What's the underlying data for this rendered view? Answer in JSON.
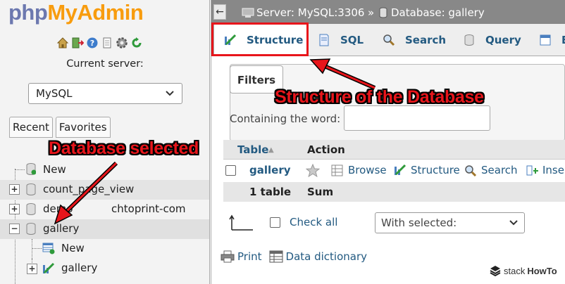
{
  "nav": {
    "logo_php": "php",
    "logo_myadmin": "MyAdmin",
    "icons": [
      "home-icon",
      "logout-icon",
      "help-icon",
      "docs-icon",
      "settings-icon",
      "reload-icon"
    ],
    "current_server_label": "Current server:",
    "server_select_value": "MySQL",
    "tabs": [
      "Recent",
      "Favorites"
    ],
    "tree": [
      {
        "label": "New",
        "level": 0
      },
      {
        "label": "count_page_view",
        "level": 0
      },
      {
        "label": "demo_...chtoprint-com",
        "label_left": "demo",
        "label_right": "chtoprint-com",
        "level": 0
      },
      {
        "label": "gallery",
        "level": 0,
        "expanded": true
      },
      {
        "label": "New",
        "level": 1
      },
      {
        "label": "gallery",
        "level": 1
      }
    ]
  },
  "breadcrumb": {
    "server": "Server: MySQL:3306",
    "separator": "»",
    "database": "Database: gallery"
  },
  "tabs": [
    {
      "label": "Structure",
      "icon": "structure-icon",
      "active": true
    },
    {
      "label": "SQL",
      "icon": "sql-icon"
    },
    {
      "label": "Search",
      "icon": "search-icon"
    },
    {
      "label": "Query",
      "icon": "query-icon"
    },
    {
      "label": "E",
      "icon": "export-icon"
    }
  ],
  "filters": {
    "legend": "Filters",
    "containing_label": "Containing the word:",
    "containing_value": ""
  },
  "table": {
    "headers": {
      "table": "Table",
      "sort_arrow": "▲",
      "action": "Action"
    },
    "rows": [
      {
        "name": "gallery",
        "actions": [
          "Browse",
          "Structure",
          "Search",
          "Inse"
        ]
      }
    ],
    "summary": {
      "count": "1 table",
      "sum": "Sum"
    }
  },
  "bulk": {
    "check_all_label": "Check all",
    "with_selected_value": "With selected:"
  },
  "bottom_links": [
    "Print",
    "Data dictionary"
  ],
  "annotations": {
    "structure": "Structure of the Database",
    "database_selected": "Database selected"
  },
  "watermark": {
    "stack": "stack",
    "howto": "HowTo"
  },
  "colors": {
    "link": "#235a81",
    "annotation": "#e8151b",
    "logo_php": "#6c78af",
    "logo_myadmin": "#f89c0e"
  }
}
